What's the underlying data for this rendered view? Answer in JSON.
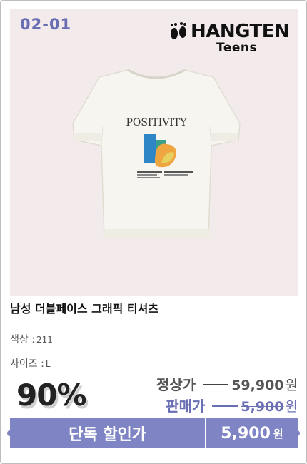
{
  "product": {
    "code": "02-01",
    "brand": {
      "name": "HANGTEN",
      "sub": "Teens"
    },
    "print_text": "POSITIVITY",
    "name": "남성 더블페이스 그래픽 티셔츠",
    "color": {
      "label": "색상 :",
      "value": "211"
    },
    "size": {
      "label": "사이즈 :",
      "value": "L"
    }
  },
  "pricing": {
    "discount": "90%",
    "regular": {
      "label": "정상가",
      "value": "59,900",
      "unit": "원"
    },
    "sale": {
      "label": "판매가",
      "value": "5,900",
      "unit": "원"
    }
  },
  "cta": {
    "label": "단독 할인가",
    "price": "5,900",
    "unit": "원"
  },
  "colors": {
    "accent": "#7e84c4",
    "code": "#6a6fb4",
    "photo_bg": "#f2eaeb"
  }
}
